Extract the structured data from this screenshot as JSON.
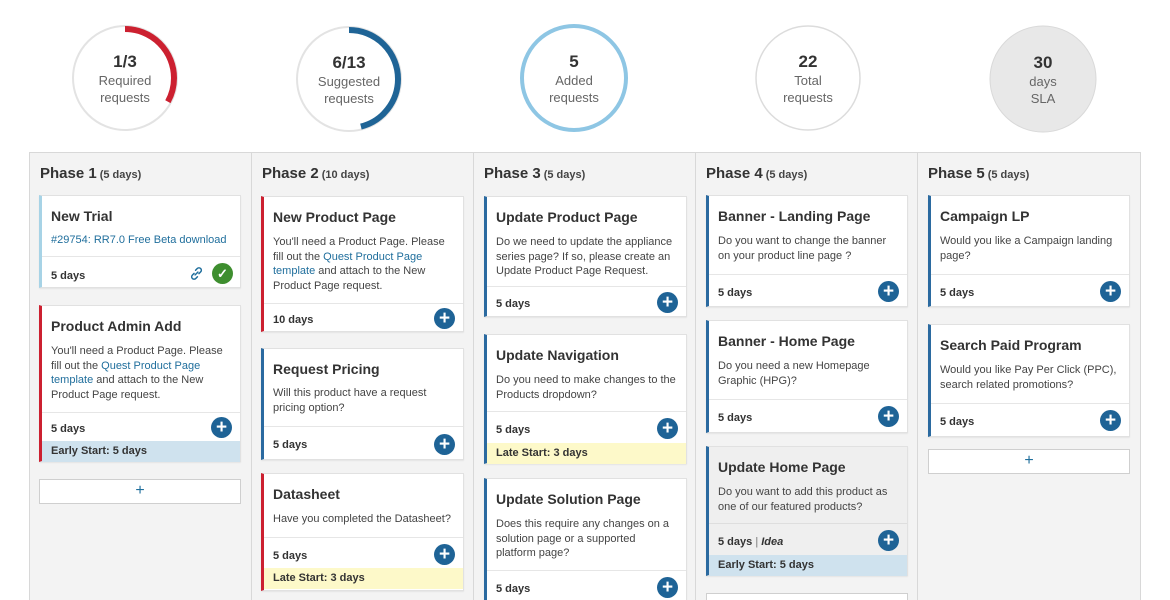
{
  "stats": [
    {
      "value": "1/3",
      "label1": "Required",
      "label2": "requests",
      "progress": 0.33,
      "color": "#cc2030"
    },
    {
      "value": "6/13",
      "label1": "Suggested",
      "label2": "requests",
      "progress": 0.46,
      "color": "#1f6496"
    },
    {
      "value": "5",
      "label1": "Added",
      "label2": "requests",
      "progress": 1.0,
      "color": "#8ec6e4"
    },
    {
      "value": "22",
      "label1": "Total",
      "label2": "requests",
      "progress": 0,
      "color": "#dddddd"
    },
    {
      "value": "30",
      "label1": "days",
      "label2": "SLA",
      "progress": 0,
      "color": "#e6e6e6"
    }
  ],
  "phases": [
    {
      "title": "Phase 1",
      "days": "(5 days)",
      "cards": [
        {
          "title": "New Trial",
          "link": "#29754: RR7.0 Free Beta download",
          "days": "5 days"
        },
        {
          "title": "Product Admin Add",
          "desc_pre": "You'll need a Product Page. Please fill out the ",
          "desc_link": "Quest Product Page template",
          "desc_post": " and attach to the New Product Page request.",
          "days": "5 days",
          "banner": "Early Start: 5 days"
        }
      ],
      "add_label": "+"
    },
    {
      "title": "Phase 2",
      "days": "(10 days)",
      "cards": [
        {
          "title": "New Product Page",
          "desc_pre": "You'll need a Product Page. Please fill out the ",
          "desc_link": "Quest Product Page template",
          "desc_post": " and attach to the New Product Page request.",
          "days": "10 days"
        },
        {
          "title": "Request Pricing",
          "desc": "Will this product have a request pricing option?",
          "days": "5 days"
        },
        {
          "title": "Datasheet",
          "desc": "Have you completed the Datasheet?",
          "days": "5 days",
          "banner": "Late Start: 3 days"
        }
      ]
    },
    {
      "title": "Phase 3",
      "days": "(5 days)",
      "cards": [
        {
          "title": "Update Product Page",
          "desc": "Do we need to update the appliance series page? If so, please create an Update Product Page Request.",
          "days": "5 days"
        },
        {
          "title": "Update Navigation",
          "desc": "Do you need to make changes to the Products dropdown?",
          "days": "5 days",
          "banner": "Late Start: 3 days"
        },
        {
          "title": "Update Solution Page",
          "desc": "Does this require any changes on a solution page or a supported platform page?",
          "days": "5 days"
        }
      ]
    },
    {
      "title": "Phase 4",
      "days": "(5 days)",
      "cards": [
        {
          "title": "Banner - Landing Page",
          "desc": "Do you want to change the banner on your product line page ?",
          "days": "5 days"
        },
        {
          "title": "Banner - Home Page",
          "desc": "Do you need a new Homepage Graphic (HPG)?",
          "days": "5 days"
        },
        {
          "title": "Update Home Page",
          "desc": "Do you want to add this product as one of our featured products?",
          "days": "5 days",
          "tag": "Idea",
          "banner": "Early Start: 5 days"
        }
      ]
    },
    {
      "title": "Phase 5",
      "days": "(5 days)",
      "cards": [
        {
          "title": "Campaign LP",
          "desc": "Would you like a Campaign landing page?",
          "days": "5 days"
        },
        {
          "title": "Search Paid Program",
          "desc": "Would you like Pay Per Click (PPC), search related promotions?",
          "days": "5 days"
        }
      ],
      "add_label": "+"
    }
  ],
  "icons": {
    "add": "plus-circle-icon",
    "link": "link-icon",
    "check": "check-circle-icon"
  },
  "add_symbol": "+",
  "idea_separator": "|",
  "check_symbol": "✓"
}
